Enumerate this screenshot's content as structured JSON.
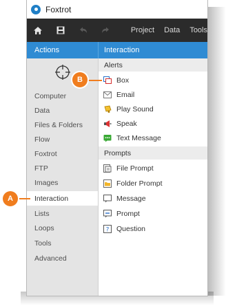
{
  "window": {
    "title": "Foxtrot"
  },
  "toolbar": {
    "menus": [
      "Project",
      "Data",
      "Tools"
    ]
  },
  "actions_panel": {
    "header": "Actions",
    "items": [
      "Computer",
      "Data",
      "Files & Folders",
      "Flow",
      "Foxtrot",
      "FTP",
      "Images",
      "Interaction",
      "Lists",
      "Loops",
      "Tools",
      "Advanced"
    ],
    "selected": "Interaction"
  },
  "interaction_panel": {
    "header": "Interaction",
    "sections": [
      {
        "title": "Alerts",
        "items": [
          "Box",
          "Email",
          "Play Sound",
          "Speak",
          "Text Message"
        ]
      },
      {
        "title": "Prompts",
        "items": [
          "File Prompt",
          "Folder Prompt",
          "Message",
          "Prompt",
          "Question"
        ]
      }
    ]
  },
  "callouts": {
    "a": "A",
    "b": "B"
  },
  "colors": {
    "accent": "#2f8bd3",
    "callout": "#f07d1e",
    "toolbar": "#2b2b2b"
  }
}
